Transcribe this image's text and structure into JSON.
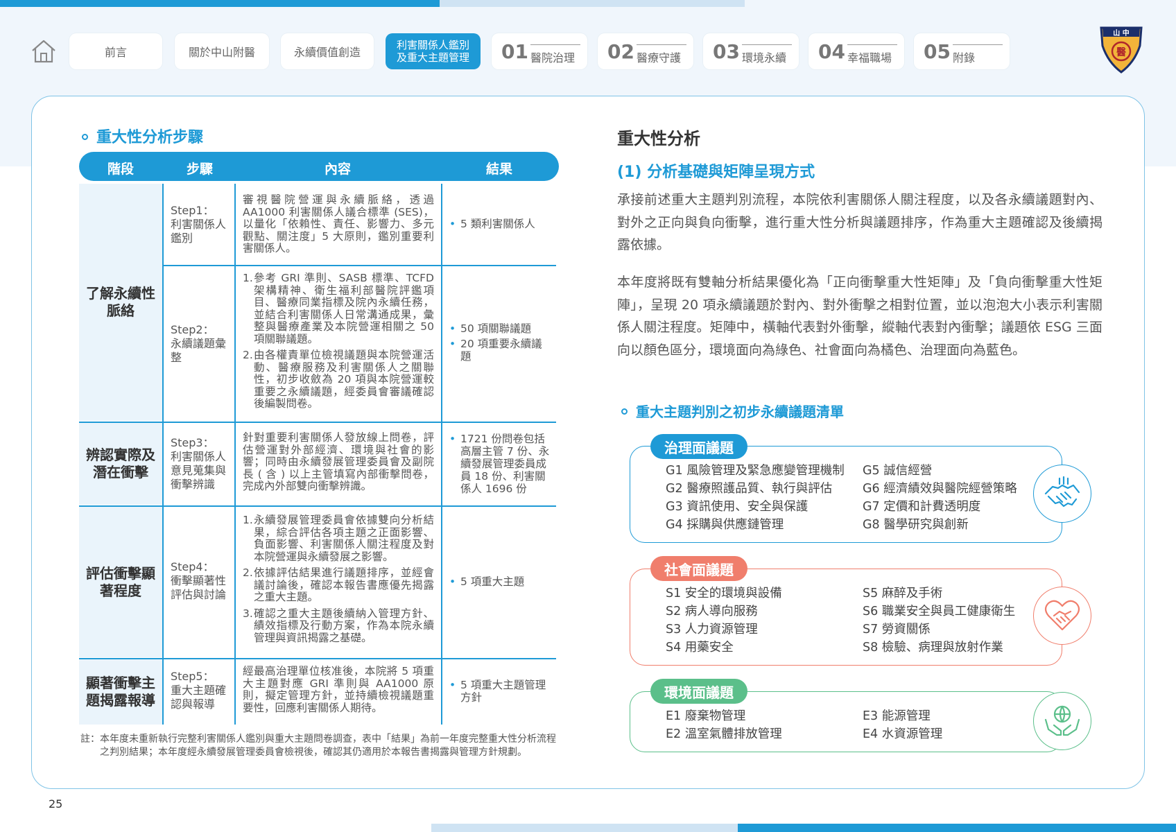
{
  "nav": {
    "tabs": [
      "前言",
      "關於中山附醫",
      "永續價值創造"
    ],
    "active_tab": [
      "利害關係人鑑別",
      "及重大主題管理"
    ],
    "chapters": [
      {
        "num": "01",
        "label": "醫院治理"
      },
      {
        "num": "02",
        "label": "醫療守護"
      },
      {
        "num": "03",
        "label": "環境永續"
      },
      {
        "num": "04",
        "label": "幸福職場"
      },
      {
        "num": "05",
        "label": "附錄"
      }
    ]
  },
  "logo": {
    "text_top": "山 中",
    "text_bottom": "醫"
  },
  "left": {
    "section_title": "重大性分析步驟",
    "headers": [
      "階段",
      "步驟",
      "內容",
      "結果"
    ],
    "stages": [
      "了解永續性脈絡",
      "辨認實際及潛在衝擊",
      "評估衝擊顯著程度",
      "顯著衝擊主題揭露報導"
    ],
    "rows": [
      {
        "step": "Step1：\n利害關係人鑑別",
        "content_text": "審視醫院營運與永續脈絡，透過 AA1000 利害關係人議合標準 (SES)，以量化「依賴性、責任、影響力、多元觀點、關注度」5 大原則，鑑別重要利害關係人。",
        "results": [
          "5 類利害關係人"
        ]
      },
      {
        "step": "Step2：\n永續議題彙整",
        "content_list": [
          "參考 GRI 準則、SASB 標準、TCFD 架構精神、衛生福利部醫院評鑑項目、醫療同業指標及院內永續任務，並結合利害關係人日常溝通成果，彙整與醫療產業及本院營運相關之 50 項關聯議題。",
          "由各權責單位檢視議題與本院營運活動、醫療服務及利害關係人之關聯性，初步收斂為 20 項與本院營運較重要之永續議題，經委員會審議確認後編製問卷。"
        ],
        "results": [
          "50 項關聯議題",
          "20 項重要永續議題"
        ]
      },
      {
        "step": "Step3：\n利害關係人意見蒐集與衝擊辨識",
        "content_text": "針對重要利害關係人發放線上問卷，評估營運對外部經濟、環境與社會的影響；同時由永續發展管理委員會及副院長 ( 含 ) 以上主管填寫內部衝擊問卷，完成內外部雙向衝擊辨識。",
        "results": [
          "1721 份問卷包括高層主管 7 份、永續發展管理委員成員 18 份、利害關係人 1696 份"
        ]
      },
      {
        "step": "Step4：\n衝擊顯著性評估與討論",
        "content_list": [
          "永續發展管理委員會依據雙向分析結果，綜合評估各項主題之正面影響、負面影響、利害關係人關注程度及對本院營運與永續發展之影響。",
          "依據評估結果進行議題排序，並經會議討論後，確認本報告書應優先揭露之重大主題。",
          "確認之重大主題後續納入管理方針、績效指標及行動方案，作為本院永續管理與資訊揭露之基礎。"
        ],
        "results": [
          "5 項重大主題"
        ]
      },
      {
        "step": "Step5：\n重大主題確認與報導",
        "content_text": "經最高治理單位核准後，本院將 5 項重大主題對應 GRI 準則與 AA1000 原則，擬定管理方針，並持續檢視議題重要性，回應利害關係人期待。",
        "results": [
          "5 項重大主題管理方針"
        ]
      }
    ],
    "note_line1": "註：本年度未重新執行完整利害關係人鑑別與重大主題問卷調查，表中「結果」為前一年度完整重大性分析流程",
    "note_line2": "之判別結果；本年度經永續發展管理委員會檢視後，確認其仍適用於本報告書揭露與管理方針規劃。"
  },
  "right": {
    "title": "重大性分析",
    "subtitle": "(1) 分析基礎與矩陣呈現方式",
    "para1": "承接前述重大主題判別流程，本院依利害關係人關注程度，以及各永續議題對內、對外之正向與負向衝擊，進行重大性分析與議題排序，作為重大主題確認及後續揭露依據。",
    "para2": "本年度將既有雙軸分析結果優化為「正向衝擊重大性矩陣」及「負向衝擊重大性矩陣」，呈現 20 項永續議題於對內、對外衝擊之相對位置，並以泡泡大小表示利害關係人關注程度。矩陣中，橫軸代表對外衝擊，縱軸代表對內衝擊；議題依 ESG 三面向以顏色區分，環境面向為綠色、社會面向為橘色、治理面向為藍色。",
    "list_title": "重大主題判別之初步永續議題清單",
    "groups": [
      {
        "label": "治理面議題",
        "color": "#1e9ad6",
        "icon": "handshake-icon",
        "col1": [
          "G1 風險管理及緊急應變管理機制",
          "G2 醫療照護品質、執行與評估",
          "G3 資訊使用、安全與保護",
          "G4 採購與供應鏈管理"
        ],
        "col2": [
          "G5 誠信經營",
          "G6 經濟績效與醫院經營策略",
          "G7 定價和計費透明度",
          "G8 醫學研究與創新"
        ]
      },
      {
        "label": "社會面議題",
        "color": "#f07e6c",
        "icon": "heart-handshake-icon",
        "col1": [
          "S1 安全的環境與設備",
          "S2 病人導向服務",
          "S3 人力資源管理",
          "S4 用藥安全"
        ],
        "col2": [
          "S5 麻醉及手術",
          "S6 職業安全與員工健康衛生",
          "S7 勞資關係",
          "S8 檢驗、病理與放射作業"
        ]
      },
      {
        "label": "環境面議題",
        "color": "#5bbf8a",
        "icon": "globe-hands-icon",
        "col1": [
          "E1 廢棄物管理",
          "E2 溫室氣體排放管理"
        ],
        "col2": [
          "E3 能源管理",
          "E4 水資源管理"
        ]
      }
    ]
  },
  "page_number": "25"
}
